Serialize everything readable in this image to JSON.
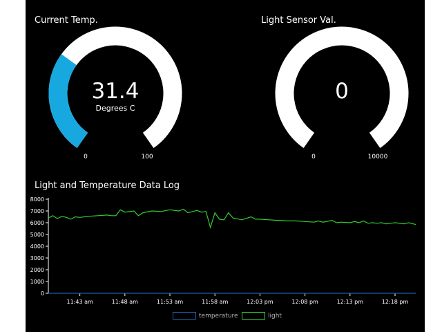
{
  "temp_gauge": {
    "title": "Current Temp.",
    "value": "31.4",
    "unit": "Degrees C",
    "min_label": "0",
    "max_label": "100",
    "fraction": 0.314,
    "fill_color": "#17a8e0",
    "track_color": "#ffffff"
  },
  "light_gauge": {
    "title": "Light Sensor Val.",
    "value": "0",
    "unit": "",
    "min_label": "0",
    "max_label": "10000",
    "fraction": 0.0,
    "fill_color": "#17a8e0",
    "track_color": "#ffffff"
  },
  "chart_title": "Light and Temperature Data Log",
  "chart_data": {
    "type": "line",
    "title": "Light and Temperature Data Log",
    "xlabel": "",
    "ylabel": "",
    "ylim": [
      0,
      8000
    ],
    "y_ticks": [
      "0",
      "1000",
      "2000",
      "3000",
      "4000",
      "5000",
      "6000",
      "7000",
      "8000"
    ],
    "x_ticks": [
      "11:43 am",
      "11:48 am",
      "11:53 am",
      "11:58 am",
      "12:03 pm",
      "12:08 pm",
      "12:13 pm",
      "12:18 pm"
    ],
    "xlim_minutes_from_first_tick": [
      -3.5,
      37.3
    ],
    "grid": false,
    "legend_position": "bottom",
    "series": [
      {
        "name": "temperature",
        "color": "#1f5fa8",
        "x": [
          -3.5,
          37.3
        ],
        "values": [
          0,
          0
        ]
      },
      {
        "name": "light",
        "color": "#33cc33",
        "x": [
          -3.5,
          -3.0,
          -2.5,
          -2.0,
          -1.5,
          -1.0,
          -0.5,
          0.0,
          0.5,
          1.0,
          2.0,
          3.0,
          3.5,
          4.0,
          4.5,
          5.0,
          6.0,
          6.5,
          7.0,
          8.0,
          9.0,
          10.0,
          11.0,
          11.5,
          12.0,
          13.0,
          13.5,
          14.0,
          14.5,
          15.0,
          15.5,
          16.0,
          16.5,
          17.0,
          18.0,
          19.0,
          19.5,
          20.0,
          21.0,
          22.0,
          23.0,
          24.0,
          25.0,
          26.0,
          26.5,
          27.0,
          28.0,
          28.5,
          29.0,
          30.0,
          30.5,
          31.0,
          31.5,
          32.0,
          32.5,
          33.0,
          33.5,
          34.0,
          34.5,
          35.0,
          36.0,
          36.5,
          37.3
        ],
        "values": [
          6400,
          6600,
          6350,
          6550,
          6450,
          6300,
          6500,
          6450,
          6500,
          6550,
          6600,
          6650,
          6600,
          6600,
          7100,
          6900,
          7000,
          6600,
          6850,
          7000,
          6950,
          7100,
          7000,
          7150,
          6850,
          7050,
          6900,
          6950,
          5600,
          6850,
          6300,
          6250,
          6850,
          6400,
          6250,
          6500,
          6300,
          6300,
          6250,
          6200,
          6150,
          6150,
          6100,
          6050,
          6150,
          6050,
          6200,
          6000,
          6050,
          6000,
          6100,
          6000,
          6150,
          5950,
          6000,
          5950,
          6000,
          5900,
          5950,
          6000,
          5900,
          6000,
          5850
        ]
      }
    ]
  }
}
